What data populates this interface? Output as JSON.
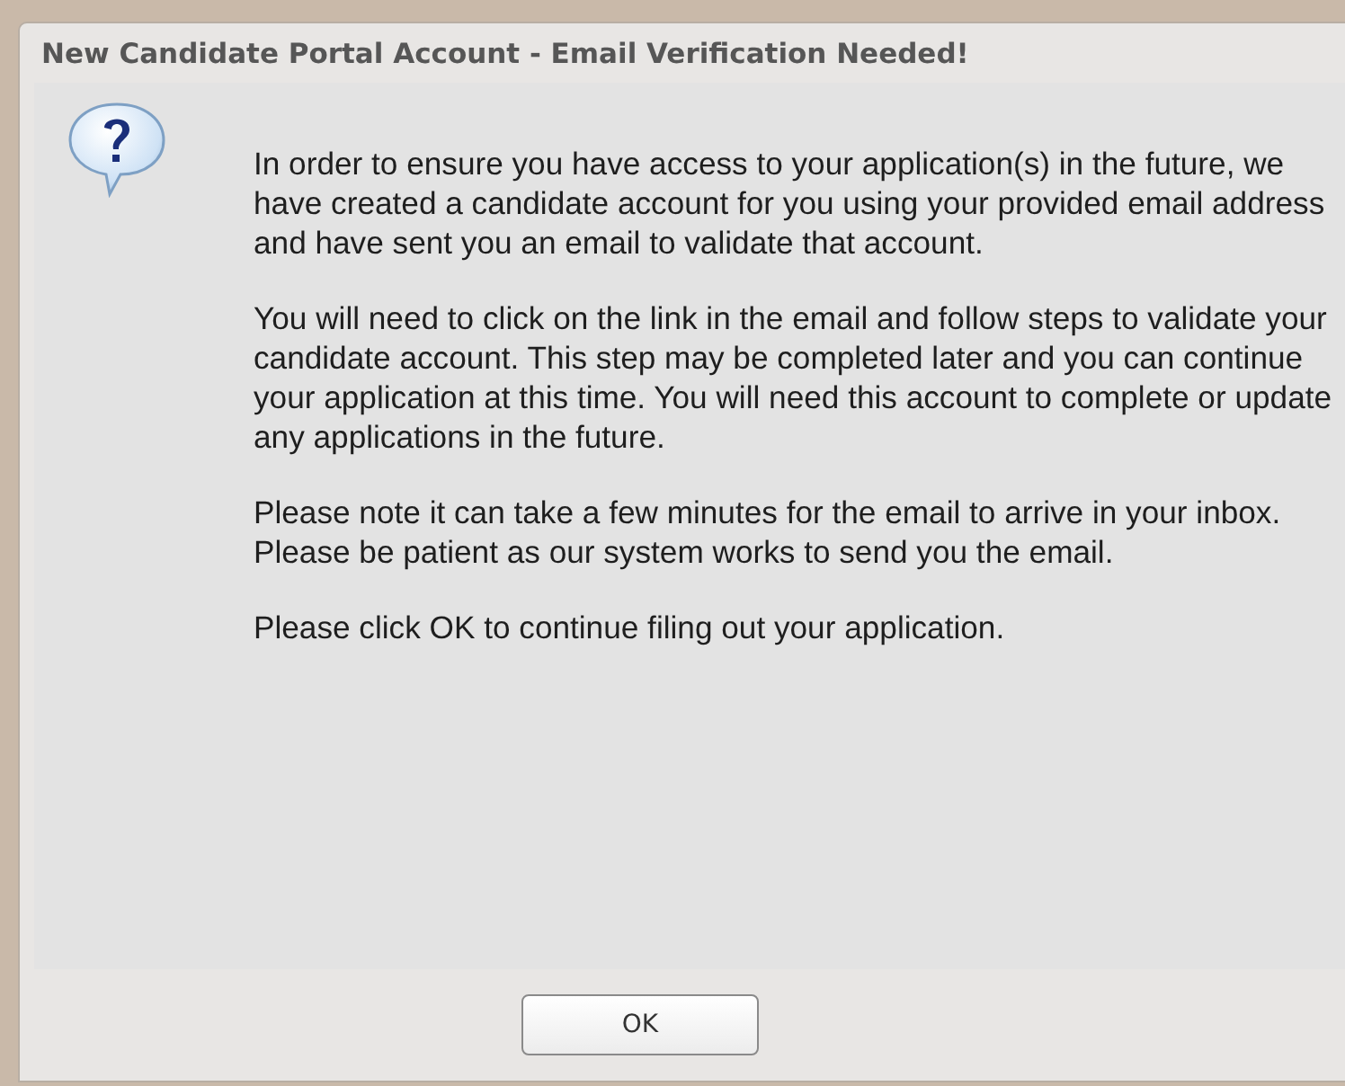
{
  "dialog": {
    "title": "New Candidate Portal Account - Email Verification Needed!",
    "paragraphs": [
      "In order to ensure you have access to your application(s) in the future, we have created a candidate account for you using your provided email address and have sent you an email to validate that account.",
      "You will need to click on the link in the email and follow steps to validate your candidate account. This step may be completed later and you can continue your application at this time. You will need this account to complete or update any applications in the future.",
      "Please note it can take a few minutes for the email to arrive in your inbox. Please be patient as our system works to send you the email.",
      "Please click OK to continue filing out your application."
    ],
    "buttons": [
      "OK"
    ]
  }
}
